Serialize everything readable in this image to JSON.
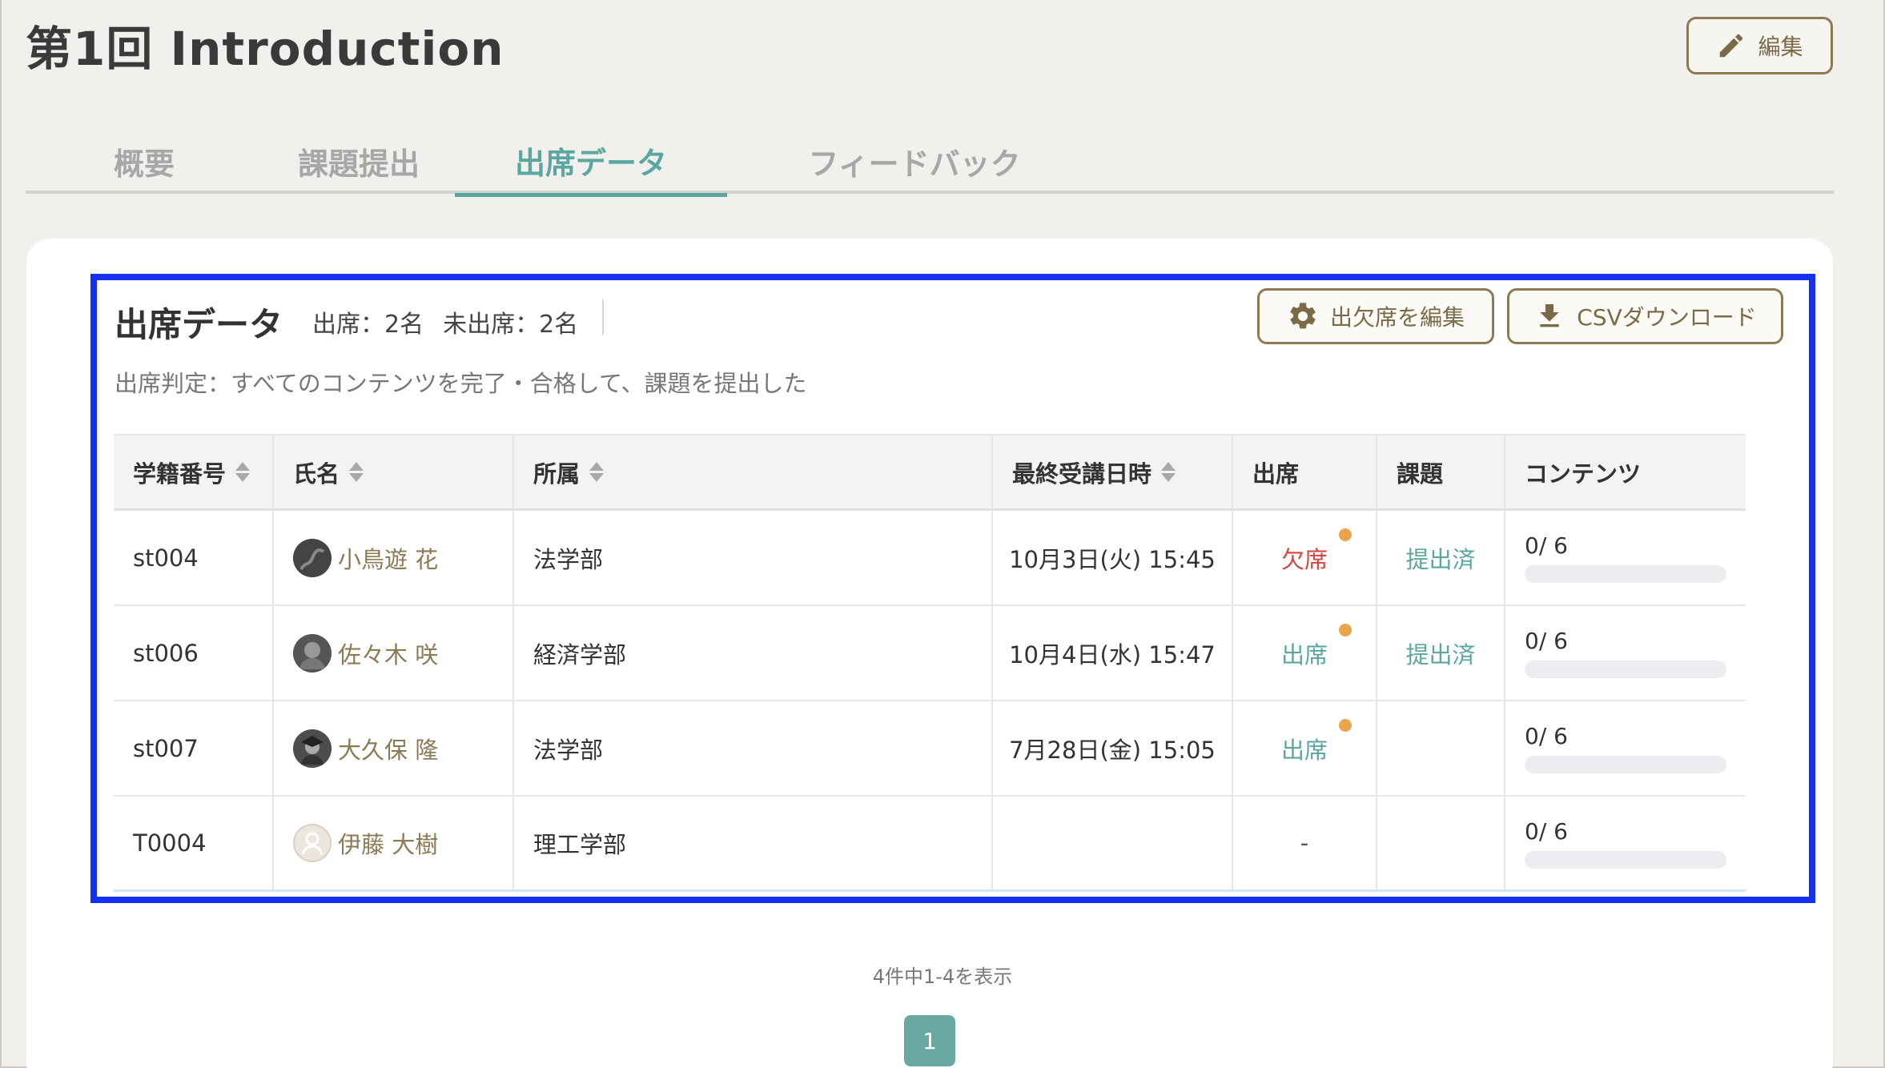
{
  "header": {
    "title": "第1回 Introduction",
    "edit_label": "編集"
  },
  "tabs": [
    {
      "label": "概要",
      "active": false
    },
    {
      "label": "課題提出",
      "active": false
    },
    {
      "label": "出席データ",
      "active": true
    },
    {
      "label": "フィードバック",
      "active": false
    }
  ],
  "attendance": {
    "title": "出席データ",
    "present_count": "出席：2名",
    "absent_count": "未出席：2名",
    "criteria": "出席判定：すべてのコンテンツを完了・合格して、課題を提出した",
    "edit_attendance_label": "出欠席を編集",
    "csv_label": "CSVダウンロード"
  },
  "table": {
    "columns": [
      "学籍番号",
      "氏名",
      "所属",
      "最終受講日時",
      "出席",
      "課題",
      "コンテンツ"
    ],
    "rows": [
      {
        "id": "st004",
        "name": "小鳥遊 花",
        "dept": "法学部",
        "last": "10月3日(火) 15:45",
        "attendance": "欠席",
        "status": "absent",
        "dot": true,
        "task": "提出済",
        "content": "0/ 6",
        "progress": 0
      },
      {
        "id": "st006",
        "name": "佐々木 咲",
        "dept": "経済学部",
        "last": "10月4日(水) 15:47",
        "attendance": "出席",
        "status": "present",
        "dot": true,
        "task": "提出済",
        "content": "0/ 6",
        "progress": 0
      },
      {
        "id": "st007",
        "name": "大久保 隆",
        "dept": "法学部",
        "last": "7月28日(金) 15:05",
        "attendance": "出席",
        "status": "present",
        "dot": true,
        "task": "",
        "content": "0/ 6",
        "progress": 0
      },
      {
        "id": "T0004",
        "name": "伊藤 大樹",
        "dept": "理工学部",
        "last": "",
        "attendance": "-",
        "status": "none",
        "dot": false,
        "task": "",
        "content": "0/ 6",
        "progress": 0
      }
    ]
  },
  "pagination": {
    "info": "4件中1-4を表示",
    "current": "1"
  },
  "colors": {
    "accent": "#5aa6a0",
    "brand": "#8c7a55",
    "absent": "#d6453d",
    "dot": "#e8a54b",
    "highlight": "#1530f0"
  }
}
